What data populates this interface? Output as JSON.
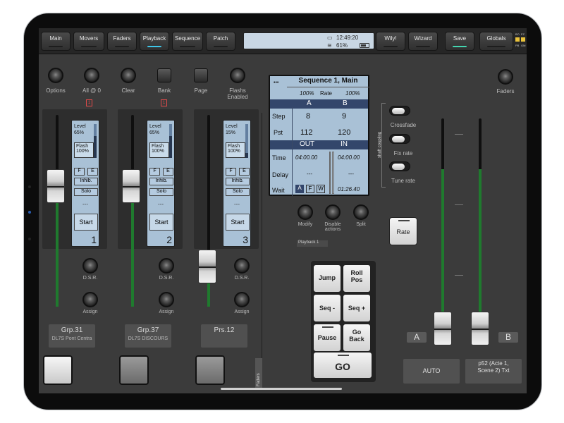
{
  "topbar": {
    "buttons": [
      {
        "label": "Main",
        "led": "off"
      },
      {
        "label": "Movers",
        "led": "off"
      },
      {
        "label": "Faders",
        "led": "off"
      },
      {
        "label": "Playback",
        "led": "on"
      },
      {
        "label": "Sequence",
        "led": "off"
      },
      {
        "label": "Patch",
        "led": "off"
      },
      {
        "label": "Wily!",
        "led": "off"
      },
      {
        "label": "Wizard",
        "led": "off"
      },
      {
        "label": "Save",
        "led": "green"
      },
      {
        "label": "Globals",
        "led": "off"
      }
    ],
    "status": {
      "clock": "12:49:20",
      "battery": "61%",
      "monitor_icon": "▭",
      "wifi_icon": "≋"
    },
    "bo_labels": {
      "bo": "BO",
      "fz": "FZ",
      "pb": "PB",
      "gm": "GM"
    }
  },
  "top_controls": [
    {
      "label": "Options",
      "kind": "round"
    },
    {
      "label": "All @ 0",
      "kind": "round"
    },
    {
      "label": "Clear",
      "kind": "round"
    },
    {
      "label": "Bank",
      "kind": "square"
    },
    {
      "label": "Page",
      "kind": "square"
    },
    {
      "label": "Flashs Enabled",
      "kind": "round"
    }
  ],
  "faders_label": "Faders",
  "strips": [
    {
      "badge": "1",
      "level_label": "Level",
      "level_value": "65%",
      "flash_label": "Flash",
      "flash_value": "100%",
      "f": "F",
      "e": "E",
      "inhib": "Inhib.",
      "solo": "Solo",
      "dash": "---",
      "start": "Start",
      "number": "1",
      "dsr": "D.S.R.",
      "assign": "Assign",
      "group": "Grp.31",
      "group_sub": "DL7S Pont Centra",
      "level_fraction": 0.65,
      "meter_fraction": 0.65
    },
    {
      "badge": "1",
      "level_label": "Level",
      "level_value": "65%",
      "flash_label": "Flash",
      "flash_value": "100%",
      "f": "F",
      "e": "E",
      "inhib": "Inhib.",
      "solo": "Solo",
      "dash": "---",
      "start": "Start",
      "number": "2",
      "dsr": "D.S.R.",
      "assign": "Assign",
      "group": "Grp.37",
      "group_sub": "DL7S DISCOURS",
      "level_fraction": 0.65,
      "meter_fraction": 0.65
    },
    {
      "badge": "",
      "level_label": "Level",
      "level_value": "15%",
      "flash_label": "Flash",
      "flash_value": "100%",
      "f": "F",
      "e": "E",
      "inhib": "Inhib.",
      "solo": "Solo",
      "dash": "---",
      "start": "Start",
      "number": "3",
      "dsr": "D.S.R.",
      "assign": "Assign",
      "group": "Prs.12",
      "group_sub": "",
      "level_fraction": 0.15,
      "meter_fraction": 0.15
    }
  ],
  "sequence": {
    "title": "Sequence 1, Main",
    "dots": "•••",
    "rate_left": "100%",
    "rate_label": "Rate",
    "rate_right": "100%",
    "col_a": "A",
    "col_b": "B",
    "step_label": "Step",
    "step_a": "8",
    "step_b": "9",
    "pst_label": "Pst",
    "pst_a": "112",
    "pst_b": "120",
    "out_label": "OUT",
    "in_label": "IN",
    "time_label": "Time",
    "time_out": "04:00.00",
    "time_in": "04:00.00",
    "delay_label": "Delay",
    "delay_out": "---",
    "delay_in": "---",
    "wait_label": "Wait",
    "wait_a": "A",
    "wait_f": "F",
    "wait_w": "W",
    "wait_in": "01:26.40"
  },
  "seq_controls": [
    {
      "label": "Modify"
    },
    {
      "label": "Disable actions"
    },
    {
      "label": "Split"
    }
  ],
  "playback_tag": "Playback 1",
  "controls": {
    "jump": "Jump",
    "roll_pos": "Roll Pos",
    "seq_minus": "Seq -",
    "seq_plus": "Seq +",
    "pause": "Pause",
    "go_back": "Go Back",
    "go": "GO"
  },
  "shaft": {
    "title": "shaft coupling",
    "crossfade": "Crossfade",
    "fix_rate": "Fix rate",
    "tune_rate": "Tune rate",
    "rate": "Rate"
  },
  "crossfade": {
    "a": "A",
    "b": "B",
    "auto": "AUTO",
    "cue": "p52 (Acte 1, Scene 2) Txt",
    "fader_a_fraction": 0.0,
    "fader_b_fraction": 0.0
  }
}
